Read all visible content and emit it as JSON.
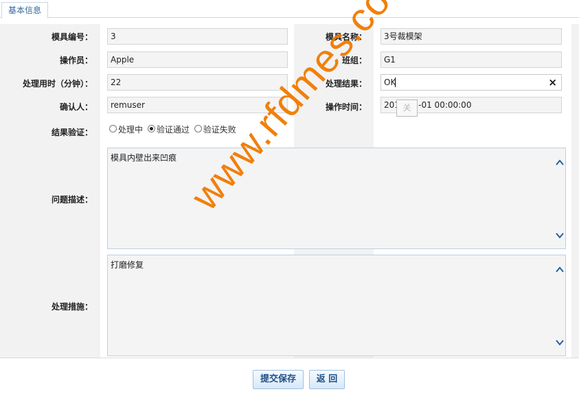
{
  "tab": {
    "label": "基本信息"
  },
  "fields": {
    "mold_no": {
      "label": "模具编号：",
      "value": "3"
    },
    "mold_name": {
      "label": "模具名称：",
      "value": "3号裁模架"
    },
    "operator": {
      "label": "操作员：",
      "value": "Apple"
    },
    "team": {
      "label": "班组：",
      "value": "G1"
    },
    "duration": {
      "label": "处理用时（分钟）：",
      "value": "22"
    },
    "result": {
      "label": "处理结果：",
      "value": "OK",
      "clear_icon": "×"
    },
    "confirmer": {
      "label": "确认人：",
      "value": "remuser"
    },
    "op_time": {
      "label": "操作时间：",
      "value": "2017-01-01 00:00:00"
    },
    "verify": {
      "label": "结果验证：",
      "options": [
        "处理中",
        "验证通过",
        "验证失败"
      ],
      "selected": "验证通过"
    },
    "problem": {
      "label": "问题描述：",
      "value": "模具内壁出来凹痕"
    },
    "measure": {
      "label": "处理措施：",
      "value": "打磨修复"
    }
  },
  "buttons": {
    "submit": "提交保存",
    "back": "返 回"
  },
  "picker_ghost": "关",
  "watermark": "www.rfdmes.com",
  "colors": {
    "tab_text": "#336699",
    "button_text": "#1f4f86",
    "watermark": "#f07a00",
    "scroll_chevron": "#1f5fa0"
  },
  "icons": {
    "clear": "close-icon",
    "scroll_up": "chevron-up-icon",
    "scroll_down": "chevron-down-icon"
  }
}
